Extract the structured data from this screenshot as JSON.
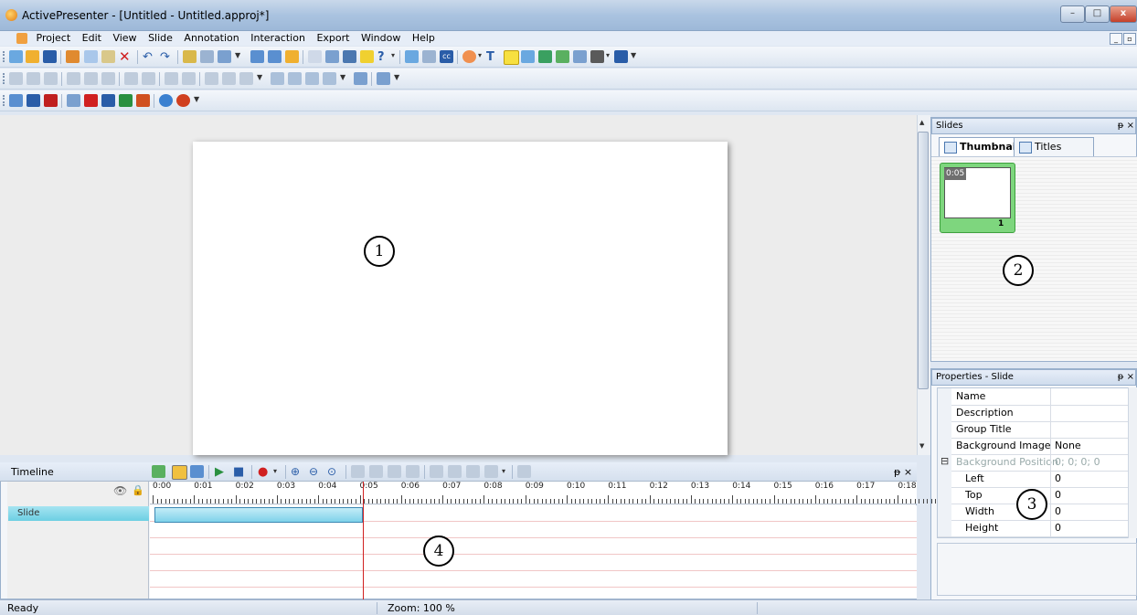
{
  "window": {
    "title": "ActivePresenter - [Untitled - Untitled.approj*]",
    "min": "–",
    "max": "□",
    "close": "x"
  },
  "menu": [
    "Project",
    "Edit",
    "View",
    "Slide",
    "Annotation",
    "Interaction",
    "Export",
    "Window",
    "Help"
  ],
  "canvas": {
    "callout": "1"
  },
  "slides_panel": {
    "title": "Slides",
    "pin": "ᵽ ×",
    "tabs": [
      "Thumbnails",
      "Titles"
    ],
    "thumb_time": "0:05",
    "thumb_number": "1",
    "callout": "2"
  },
  "properties_panel": {
    "title": "Properties - Slide",
    "pin": "ᵽ ×",
    "rows": [
      {
        "key": "Name",
        "value": ""
      },
      {
        "key": "Description",
        "value": ""
      },
      {
        "key": "Group Title",
        "value": ""
      },
      {
        "key": "Background Image",
        "value": "None"
      },
      {
        "key": "Background Position",
        "value": "0; 0; 0; 0"
      },
      {
        "key": "Left",
        "value": "0"
      },
      {
        "key": "Top",
        "value": "0"
      },
      {
        "key": "Width",
        "value": "0"
      },
      {
        "key": "Height",
        "value": "0"
      }
    ],
    "collapse_symbol": "⊟",
    "callout": "3"
  },
  "timeline": {
    "title": "Timeline",
    "close": "ᵽ ×",
    "ticks": [
      "0:00",
      "0:01",
      "0:02",
      "0:03",
      "0:04",
      "0:05",
      "0:06",
      "0:07",
      "0:08",
      "0:09",
      "0:10",
      "0:11",
      "0:12",
      "0:13",
      "0:14",
      "0:15",
      "0:16",
      "0:17",
      "0:18"
    ],
    "track_label": "Slide",
    "callout": "4"
  },
  "status": {
    "left": "Ready",
    "zoom": "Zoom: 100 %"
  },
  "colors": {
    "title_bar": "#aac3e0",
    "thumb_selected": "#7ed67e",
    "slide_track": "#7fd2ea",
    "playhead": "#d02020"
  }
}
